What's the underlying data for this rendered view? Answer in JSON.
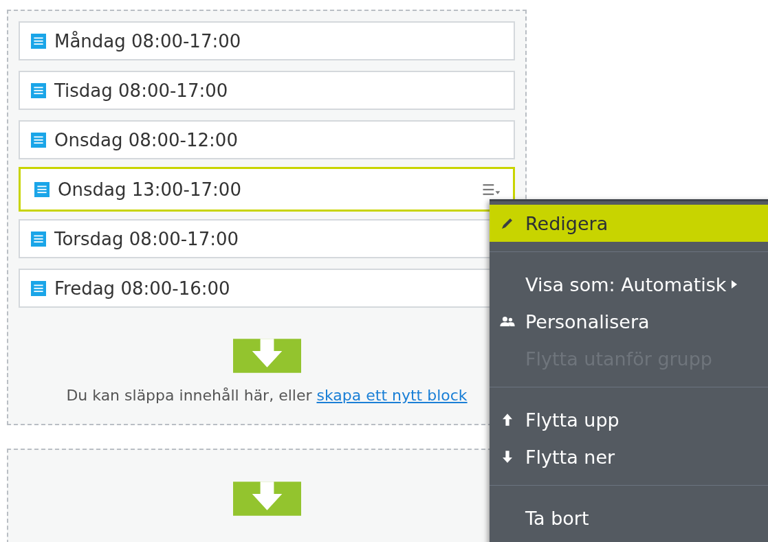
{
  "blocks": [
    {
      "label": "Måndag 08:00-17:00",
      "selected": false
    },
    {
      "label": "Tisdag 08:00-17:00",
      "selected": false
    },
    {
      "label": "Onsdag 08:00-12:00",
      "selected": false
    },
    {
      "label": "Onsdag 13:00-17:00",
      "selected": true
    },
    {
      "label": "Torsdag 08:00-17:00",
      "selected": false
    },
    {
      "label": "Fredag 08:00-16:00",
      "selected": false
    }
  ],
  "drop_zone": {
    "text": "Du kan släppa innehåll här, eller ",
    "link": "skapa ett nytt block"
  },
  "context_menu": {
    "groups": [
      [
        {
          "label": "Redigera",
          "kind": "edit",
          "highlighted": true,
          "disabled": false,
          "submenu": false
        }
      ],
      [
        {
          "label": "Visa som: Automatisk",
          "kind": "plain",
          "highlighted": false,
          "disabled": false,
          "submenu": true
        },
        {
          "label": "Personalisera",
          "kind": "personalize",
          "highlighted": false,
          "disabled": false,
          "submenu": false
        },
        {
          "label": "Flytta utanför grupp",
          "kind": "plain",
          "highlighted": false,
          "disabled": true,
          "submenu": false
        }
      ],
      [
        {
          "label": "Flytta upp",
          "kind": "move-up",
          "highlighted": false,
          "disabled": false,
          "submenu": false
        },
        {
          "label": "Flytta ner",
          "kind": "move-down",
          "highlighted": false,
          "disabled": false,
          "submenu": false
        }
      ],
      [
        {
          "label": "Ta bort",
          "kind": "plain",
          "highlighted": false,
          "disabled": false,
          "submenu": false
        }
      ]
    ]
  }
}
